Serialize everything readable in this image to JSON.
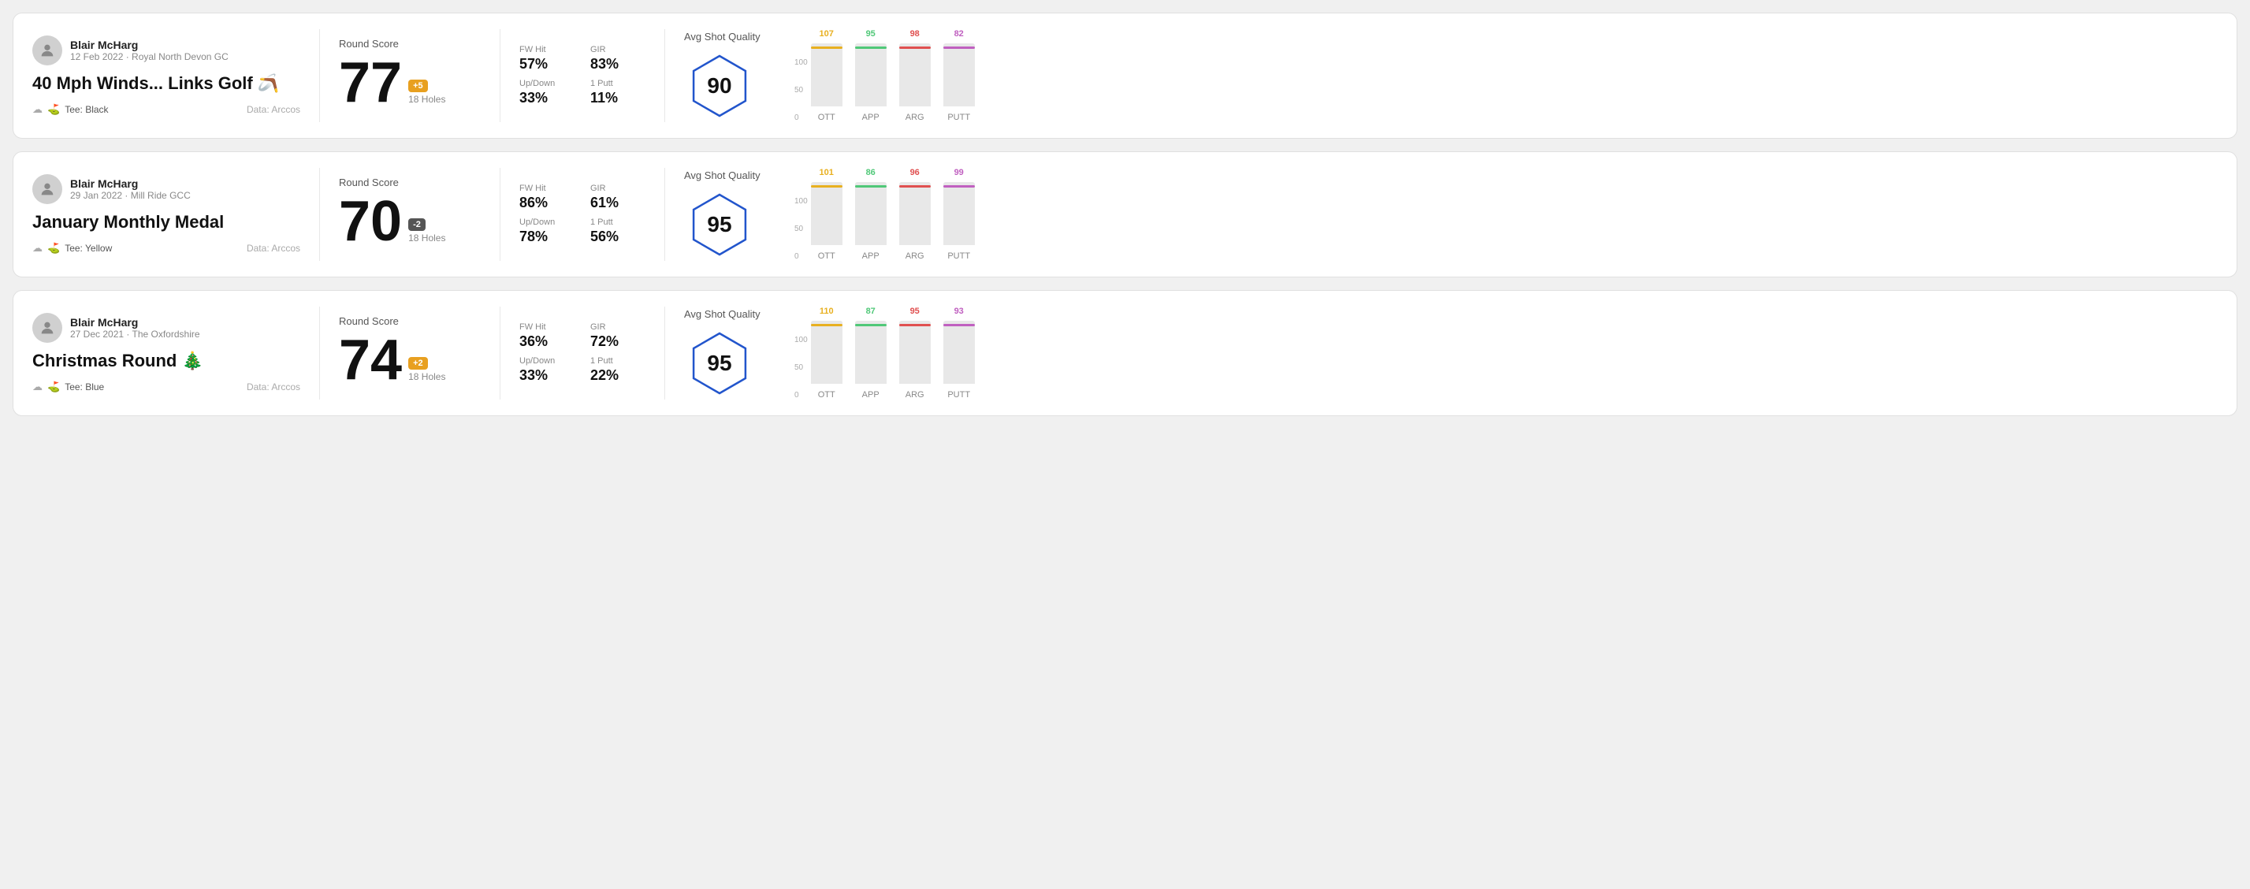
{
  "rounds": [
    {
      "id": "round1",
      "user": {
        "name": "Blair McHarg",
        "date_course": "12 Feb 2022 · Royal North Devon GC"
      },
      "title": "40 Mph Winds... Links Golf 🪃",
      "tee": "Black",
      "data_source": "Data: Arccos",
      "score": 77,
      "score_diff": "+5",
      "score_diff_type": "positive",
      "holes": "18 Holes",
      "fw_hit": "57%",
      "gir": "83%",
      "up_down": "33%",
      "one_putt": "11%",
      "avg_shot_quality": 90,
      "chart": {
        "bars": [
          {
            "label": "OTT",
            "value": 107,
            "color": "#e8b020"
          },
          {
            "label": "APP",
            "value": 95,
            "color": "#50c878"
          },
          {
            "label": "ARG",
            "value": 98,
            "color": "#e05050"
          },
          {
            "label": "PUTT",
            "value": 82,
            "color": "#c060c0"
          }
        ]
      }
    },
    {
      "id": "round2",
      "user": {
        "name": "Blair McHarg",
        "date_course": "29 Jan 2022 · Mill Ride GCC"
      },
      "title": "January Monthly Medal",
      "tee": "Yellow",
      "data_source": "Data: Arccos",
      "score": 70,
      "score_diff": "-2",
      "score_diff_type": "negative",
      "holes": "18 Holes",
      "fw_hit": "86%",
      "gir": "61%",
      "up_down": "78%",
      "one_putt": "56%",
      "avg_shot_quality": 95,
      "chart": {
        "bars": [
          {
            "label": "OTT",
            "value": 101,
            "color": "#e8b020"
          },
          {
            "label": "APP",
            "value": 86,
            "color": "#50c878"
          },
          {
            "label": "ARG",
            "value": 96,
            "color": "#e05050"
          },
          {
            "label": "PUTT",
            "value": 99,
            "color": "#c060c0"
          }
        ]
      }
    },
    {
      "id": "round3",
      "user": {
        "name": "Blair McHarg",
        "date_course": "27 Dec 2021 · The Oxfordshire"
      },
      "title": "Christmas Round 🎄",
      "tee": "Blue",
      "data_source": "Data: Arccos",
      "score": 74,
      "score_diff": "+2",
      "score_diff_type": "positive",
      "holes": "18 Holes",
      "fw_hit": "36%",
      "gir": "72%",
      "up_down": "33%",
      "one_putt": "22%",
      "avg_shot_quality": 95,
      "chart": {
        "bars": [
          {
            "label": "OTT",
            "value": 110,
            "color": "#e8b020"
          },
          {
            "label": "APP",
            "value": 87,
            "color": "#50c878"
          },
          {
            "label": "ARG",
            "value": 95,
            "color": "#e05050"
          },
          {
            "label": "PUTT",
            "value": 93,
            "color": "#c060c0"
          }
        ]
      }
    }
  ],
  "labels": {
    "round_score": "Round Score",
    "fw_hit": "FW Hit",
    "gir": "GIR",
    "up_down": "Up/Down",
    "one_putt": "1 Putt",
    "avg_shot_quality": "Avg Shot Quality",
    "tee_prefix": "Tee: ",
    "data_arccos": "Data: Arccos"
  }
}
